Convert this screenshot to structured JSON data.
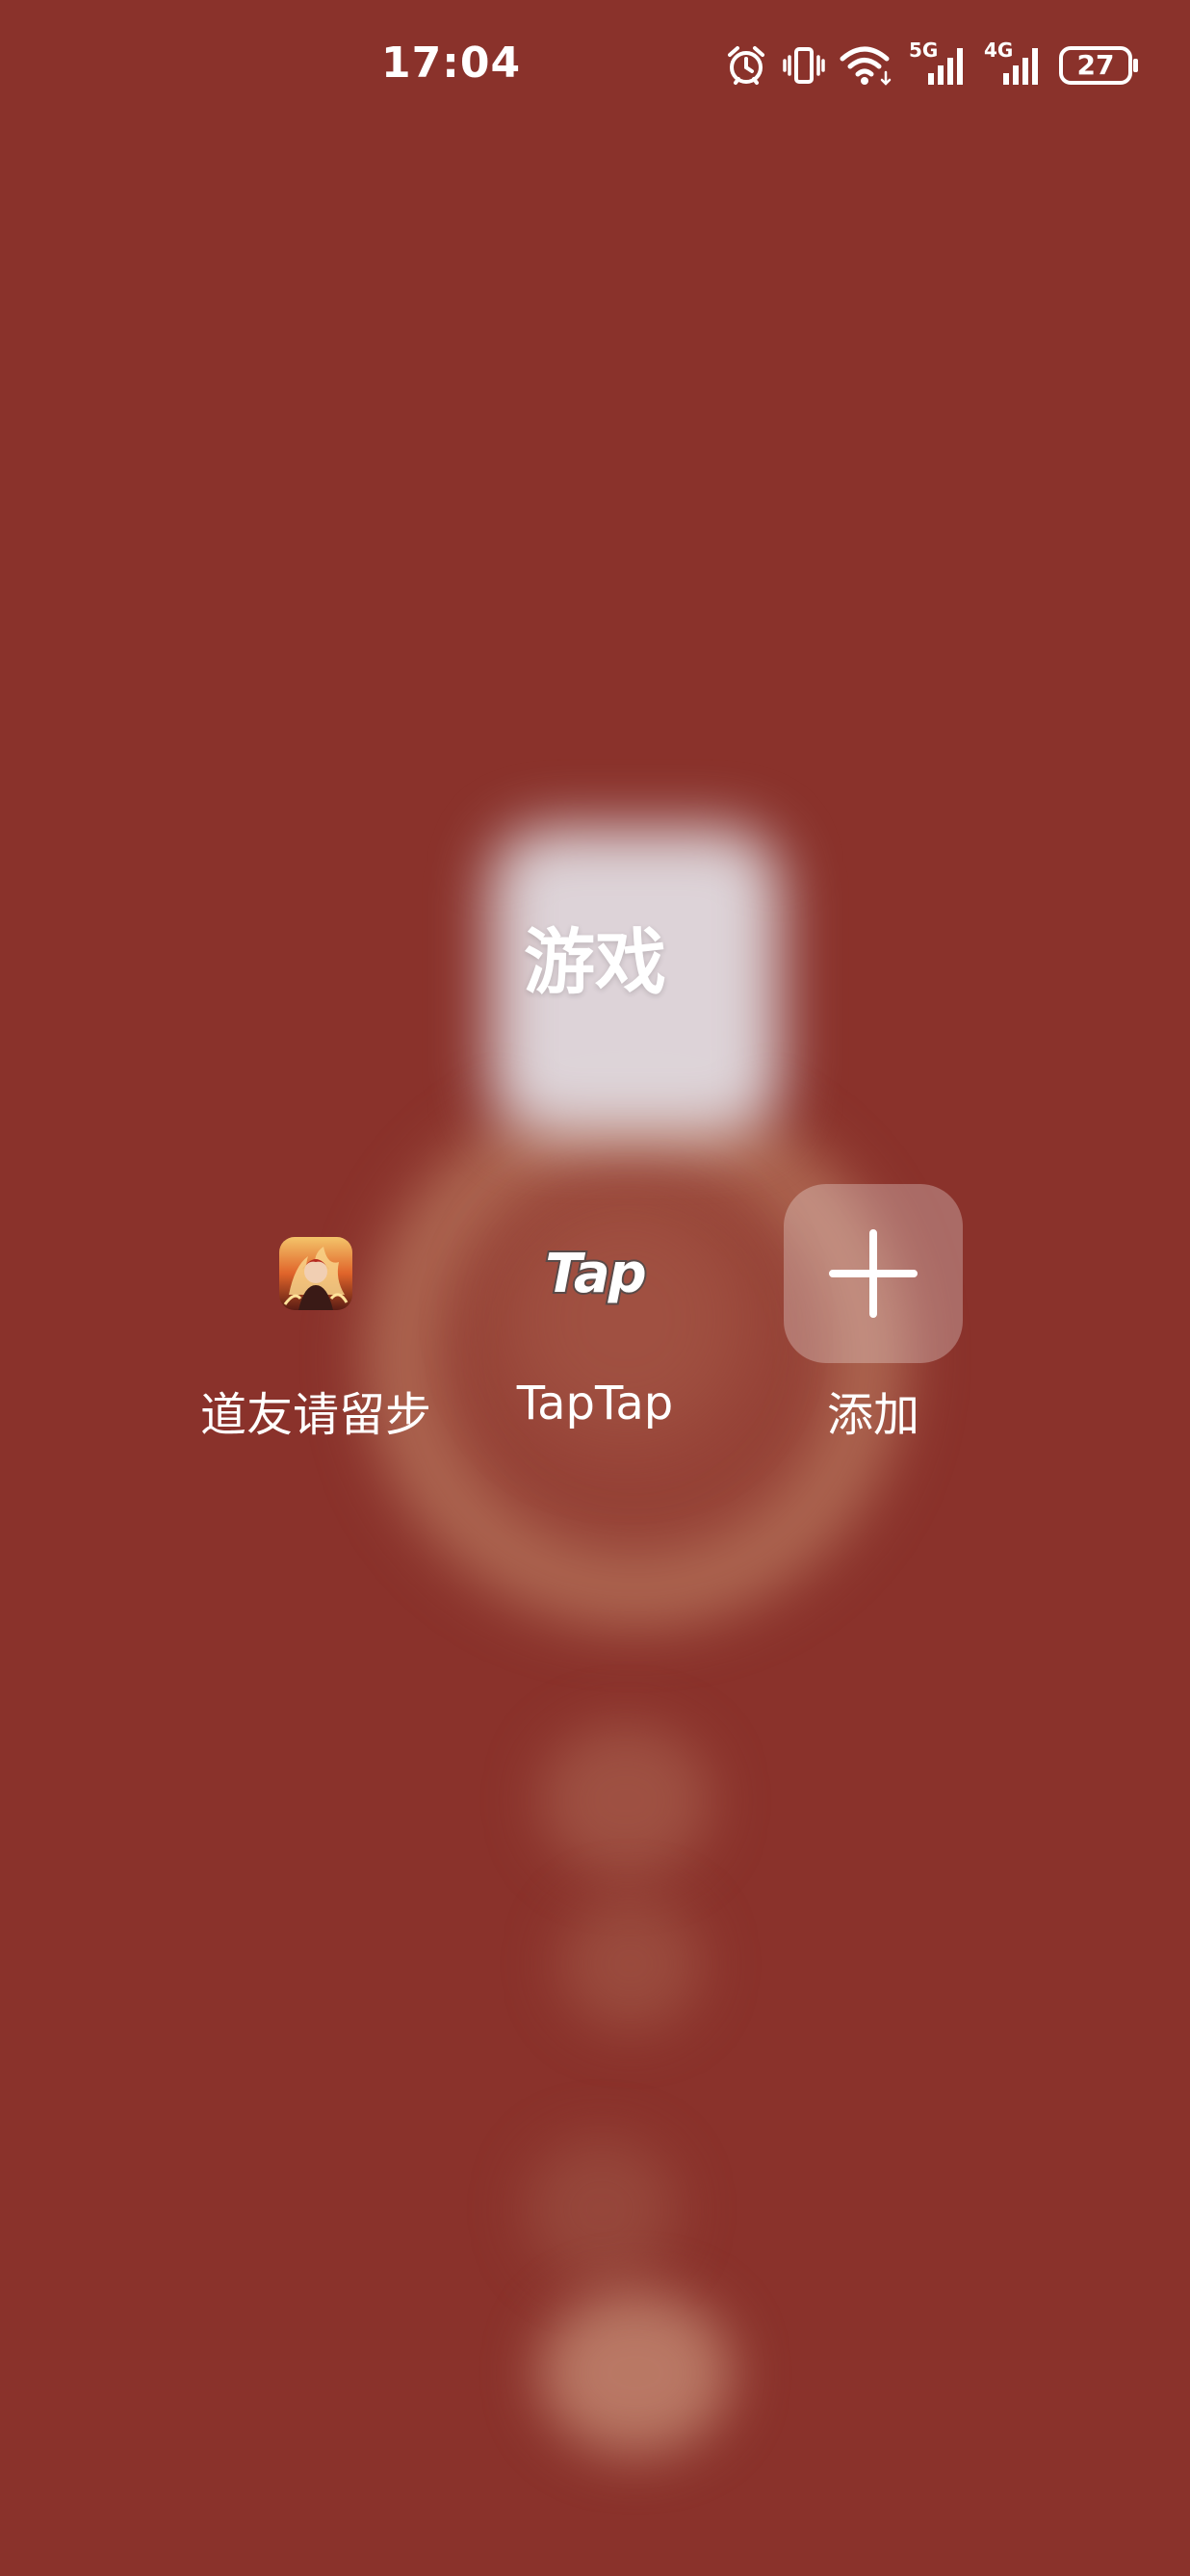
{
  "status_bar": {
    "time": "17:04",
    "network_5g": "5G",
    "network_4g": "4G",
    "battery": "27"
  },
  "folder": {
    "title": "游戏"
  },
  "apps": [
    {
      "label": "道友请留步",
      "icon": "game-character-icon"
    },
    {
      "label": "TapTap",
      "icon": "taptap-logo-icon",
      "logo_text": "Tap"
    },
    {
      "label": "添加",
      "icon": "plus-icon"
    }
  ],
  "colors": {
    "background": "#8a322b",
    "text": "#ffffff"
  }
}
